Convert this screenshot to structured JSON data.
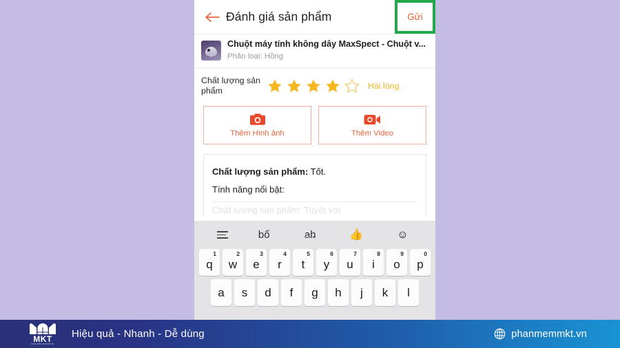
{
  "appbar": {
    "back_icon": "back-arrow-icon",
    "title": "Đánh giá sản phẩm",
    "send_label": "Gửi",
    "highlight_color": "#22a84a",
    "accent_color": "#e8643c"
  },
  "product": {
    "title": "Chuột máy tính không dây MaxSpect - Chuột v...",
    "variant": "Phân loại: Hồng",
    "thumb_icon": "product-thumbnail"
  },
  "rating": {
    "label": "Chất lượng sản phẩm",
    "value": 4,
    "max": 5,
    "satisfaction_label": "Hài lòng",
    "star_color": "#f5b820",
    "star_empty_color": "#f3cf7e"
  },
  "media": [
    {
      "label": "Thêm Hình ảnh",
      "icon": "camera-icon"
    },
    {
      "label": "Thêm Video",
      "icon": "video-camera-icon"
    }
  ],
  "review": {
    "line1_bold": "Chất lượng sản phẩm:",
    "line1_rest": " Tốt.",
    "line2": "Tính năng nổi bật:",
    "line3_partial": "Chất lượng sản phẩm: Tuyệt vời"
  },
  "keyboard": {
    "suggestions": [
      {
        "type": "icon",
        "name": "hamburger-menu-icon",
        "text": ""
      },
      {
        "type": "word",
        "name": "suggestion-bo",
        "text": "bố"
      },
      {
        "type": "word",
        "name": "suggestion-ah",
        "text": "ah",
        "dots": "•••"
      },
      {
        "type": "emoji",
        "name": "thumbs-up-emoji",
        "text": "👍"
      },
      {
        "type": "emoji",
        "name": "smiley-emoji",
        "text": "☺"
      }
    ],
    "row1": [
      {
        "char": "q",
        "num": "1"
      },
      {
        "char": "w",
        "num": "2"
      },
      {
        "char": "e",
        "num": "3"
      },
      {
        "char": "r",
        "num": "4"
      },
      {
        "char": "t",
        "num": "5"
      },
      {
        "char": "y",
        "num": "6"
      },
      {
        "char": "u",
        "num": "7"
      },
      {
        "char": "i",
        "num": "8"
      },
      {
        "char": "o",
        "num": "9"
      },
      {
        "char": "p",
        "num": "0"
      }
    ],
    "row2": [
      {
        "char": "a"
      },
      {
        "char": "s"
      },
      {
        "char": "d"
      },
      {
        "char": "f"
      },
      {
        "char": "g"
      },
      {
        "char": "h"
      },
      {
        "char": "j"
      },
      {
        "char": "k"
      },
      {
        "char": "l"
      }
    ]
  },
  "footer": {
    "logo_text": "MKT",
    "logo_sub": "PHẦN MỀM MARKETING",
    "tagline": "Hiệu quả - Nhanh - Dễ dùng",
    "site": "phanmemmkt.vn",
    "globe_icon": "globe-icon"
  }
}
